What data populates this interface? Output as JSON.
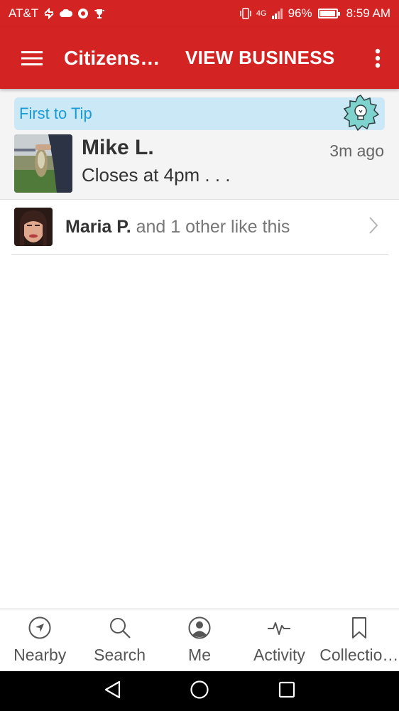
{
  "status_bar": {
    "carrier": "AT&T",
    "network": "4G",
    "battery_percent": "96%",
    "battery_level": 0.96,
    "time": "8:59 AM"
  },
  "app_bar": {
    "menu_icon": "hamburger-menu-icon",
    "title": "Citizens…",
    "action_label": "VIEW BUSINESS",
    "overflow_icon": "more-vertical-icon"
  },
  "tip": {
    "banner_label": "First to Tip",
    "badge_icon": "lightbulb-badge-icon",
    "author_name": "Mike L.",
    "time_ago": "3m ago",
    "text": "Closes at 4pm . . ."
  },
  "likes": {
    "name": "Maria P.",
    "suffix": " and 1 other like this",
    "chevron_icon": "chevron-right-icon"
  },
  "bottom_nav": {
    "items": [
      {
        "label": "Nearby",
        "icon": "compass-icon"
      },
      {
        "label": "Search",
        "icon": "search-icon"
      },
      {
        "label": "Me",
        "icon": "profile-icon"
      },
      {
        "label": "Activity",
        "icon": "activity-icon"
      },
      {
        "label": "Collectio…",
        "icon": "bookmark-icon"
      }
    ]
  },
  "system_nav": {
    "back_icon": "back-triangle-icon",
    "home_icon": "home-circle-icon",
    "recents_icon": "recents-square-icon"
  },
  "colors": {
    "brand_red": "#d32323",
    "tip_banner_bg": "#cbe8f6",
    "tip_banner_text": "#1a9bd7"
  }
}
